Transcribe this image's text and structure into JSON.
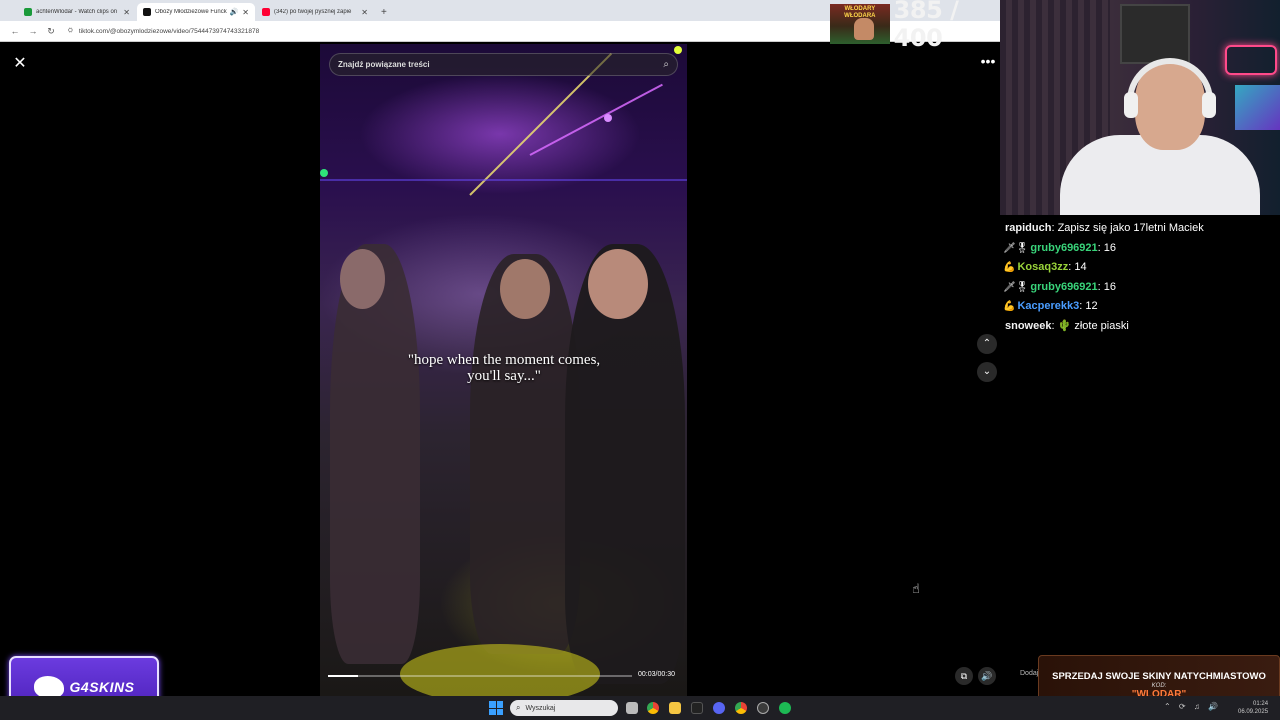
{
  "browser": {
    "tabs": [
      {
        "label": "achtenWlodar - Watch clips on",
        "color": "#1a9a3a",
        "active": false
      },
      {
        "label": "Obozy Młodzieżowe Funck",
        "color": "#111111",
        "active": true
      },
      {
        "label": "(342) po twojej pysznej zapie",
        "color": "#ff0033",
        "active": false
      }
    ],
    "url": "tiktok.com/@obozymlodziezowe/video/7544473974743321878"
  },
  "sub_goal": {
    "banner": "WŁODARY WŁODARA",
    "count": "385 / 400"
  },
  "player": {
    "search_placeholder": "Znajdź powiązane treści",
    "caption_line1": "\"hope when the moment comes,",
    "caption_line2": "you'll say...\"",
    "time": "00:03/00:30",
    "progress": 0.1
  },
  "chat": [
    {
      "badges": "",
      "user": "rapiduch",
      "color": "#f3f3f3",
      "text": "Zapisz się jako 17letni Maciek"
    },
    {
      "badges": "🗡🎖",
      "user": "gruby696921",
      "color": "#39d47a",
      "text": "16"
    },
    {
      "badges": "💪",
      "user": "Kosaq3zz",
      "color": "#9ad43a",
      "text": "14"
    },
    {
      "badges": "🗡🎖",
      "user": "gruby696921",
      "color": "#39d47a",
      "text": "16"
    },
    {
      "badges": "💪",
      "user": "Kacperekk3",
      "color": "#4a9dff",
      "text": "12"
    },
    {
      "badges": "",
      "user": "snoweek",
      "color": "#f3f3f3",
      "text": "🌵 złote piaski"
    }
  ],
  "sponsor": {
    "name": "G4SKINS"
  },
  "promo": {
    "headline": "SPRZEDAJ SWOJE SKINY NATYCHMIASTOWO",
    "code_label": "KOD:",
    "code": "\"WLODAR\"",
    "side_text": "Dodaj k"
  },
  "taskbar": {
    "search_label": "Wyszukaj",
    "time": "01:24",
    "date": "06.09.2025"
  }
}
